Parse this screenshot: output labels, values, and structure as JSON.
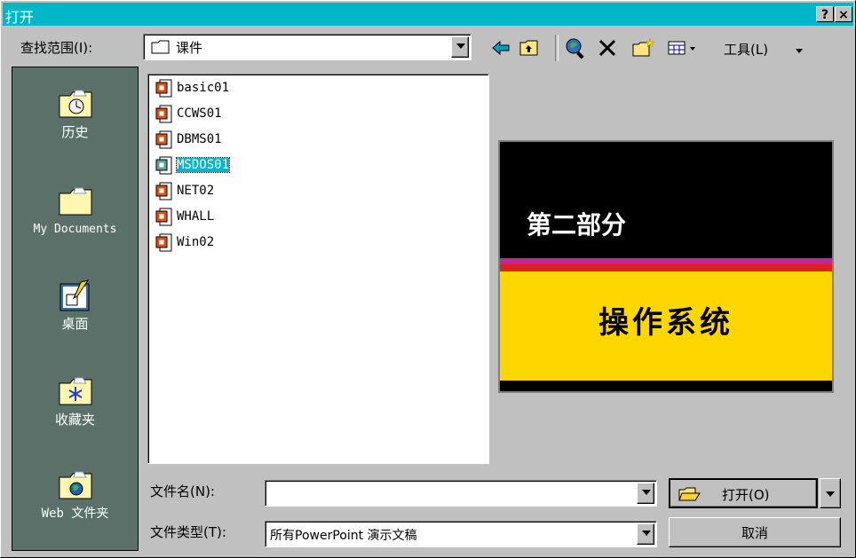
{
  "title": "打开",
  "title_buttons": {
    "help": "?",
    "close": "×"
  },
  "lookin": {
    "label": "查找范围(I):",
    "value": "课件"
  },
  "toolbar": {
    "tools_label": "工具(L)"
  },
  "places": [
    {
      "label": "历史",
      "icon": "history-folder-icon"
    },
    {
      "label": "My Documents",
      "icon": "my-documents-folder-icon"
    },
    {
      "label": "桌面",
      "icon": "desktop-icon"
    },
    {
      "label": "收藏夹",
      "icon": "favorites-folder-icon"
    },
    {
      "label": "Web 文件夹",
      "icon": "web-folder-icon"
    }
  ],
  "files": [
    {
      "name": "basic01",
      "selected": false
    },
    {
      "name": "CCWS01",
      "selected": false
    },
    {
      "name": "DBMS01",
      "selected": false
    },
    {
      "name": "MSDOS01",
      "selected": true
    },
    {
      "name": "NET02",
      "selected": false
    },
    {
      "name": "WHALL",
      "selected": false
    },
    {
      "name": "Win02",
      "selected": false
    }
  ],
  "preview": {
    "heading": "第二部分",
    "subtitle": "操作系统",
    "colors": {
      "background": "#000000",
      "stripe_magenta": "#c0289a",
      "stripe_red": "#e02020",
      "band_yellow": "#ffd700"
    }
  },
  "filename": {
    "label": "文件名(N):",
    "value": ""
  },
  "filetype": {
    "label": "文件类型(T):",
    "value": "所有PowerPoint 演示文稿"
  },
  "buttons": {
    "open": "打开(O)",
    "cancel": "取消"
  },
  "colors": {
    "titlebar": "#00b7c9",
    "face": "#c0c0c0",
    "places_bg": "#5a7068",
    "selection": "#00b7c9"
  }
}
